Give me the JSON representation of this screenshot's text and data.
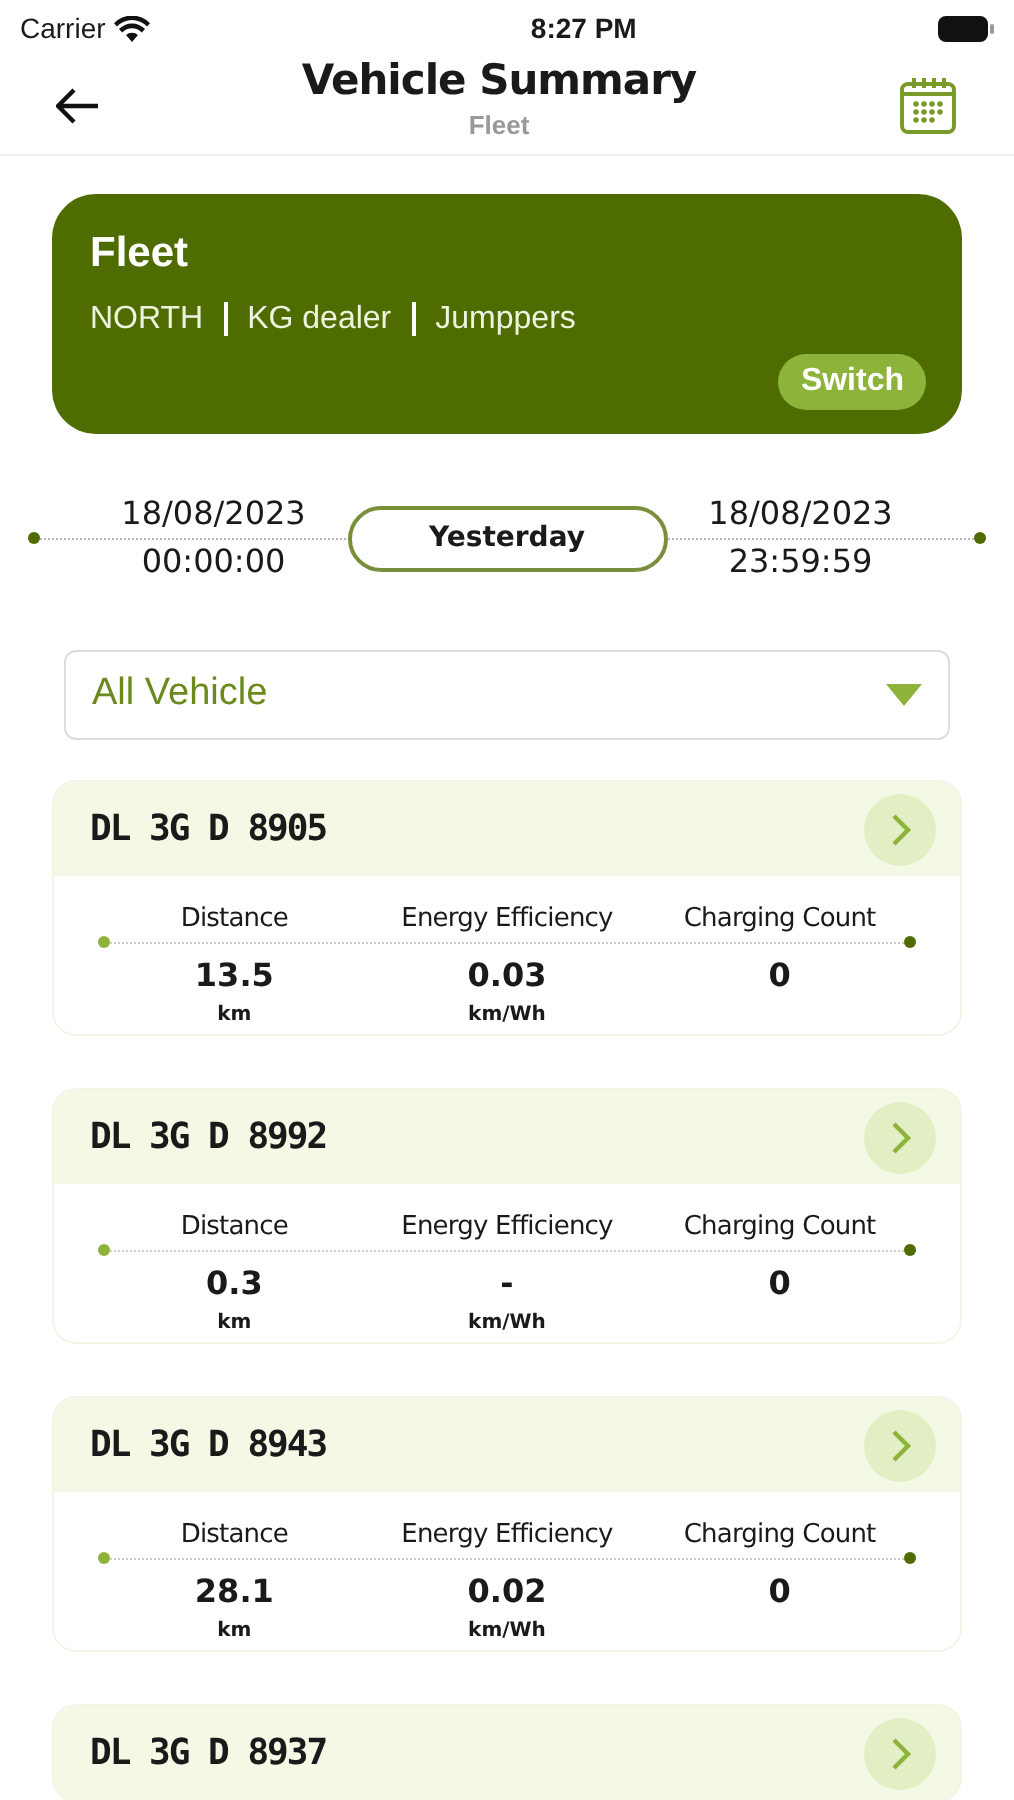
{
  "status_bar": {
    "carrier": "Carrier",
    "time": "8:27 PM"
  },
  "header": {
    "title": "Vehicle Summary",
    "subtitle": "Fleet"
  },
  "fleet_card": {
    "title": "Fleet",
    "path": [
      "NORTH",
      "KG dealer",
      "Jumppers"
    ],
    "button": "Switch"
  },
  "date_range": {
    "start_date": "18/08/2023",
    "start_time": "00:00:00",
    "preset": "Yesterday",
    "end_date": "18/08/2023",
    "end_time": "23:59:59"
  },
  "vehicle_filter": {
    "value": "All Vehicle"
  },
  "vehicles": [
    {
      "plate": "DL 3G D 8905",
      "stats": [
        {
          "label": "Distance",
          "value": "13.5",
          "unit": "km"
        },
        {
          "label": "Energy Efficiency",
          "value": "0.03",
          "unit": "km/Wh"
        },
        {
          "label": "Charging Count",
          "value": "0"
        }
      ]
    },
    {
      "plate": "DL 3G D 8992",
      "stats": [
        {
          "label": "Distance",
          "value": "0.3",
          "unit": "km"
        },
        {
          "label": "Energy Efficiency",
          "value": "-",
          "unit": "km/Wh"
        },
        {
          "label": "Charging Count",
          "value": "0"
        }
      ]
    },
    {
      "plate": "DL 3G D 8943",
      "stats": [
        {
          "label": "Distance",
          "value": "28.1",
          "unit": "km"
        },
        {
          "label": "Energy Efficiency",
          "value": "0.02",
          "unit": "km/Wh"
        },
        {
          "label": "Charging Count",
          "value": "0"
        }
      ]
    },
    {
      "plate": "DL 3G D 8937"
    }
  ]
}
